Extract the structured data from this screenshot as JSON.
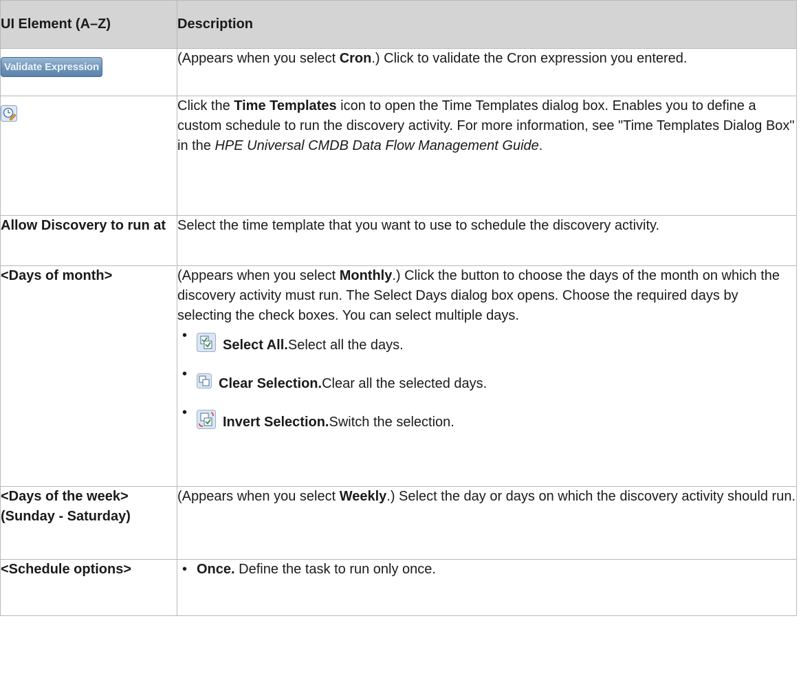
{
  "table": {
    "headers": {
      "element": "UI Element (A–Z)",
      "description": "Description"
    },
    "validate": {
      "button_label": "Validate Expression",
      "pre": "(Appears when you select ",
      "bold": "Cron",
      "post": ".) Click to validate the Cron expression you entered."
    },
    "time_templates": {
      "pre": "Click the ",
      "bold": "Time Templates",
      "mid": " icon to open the Time Templates dialog box. Enables you to define a custom schedule to run the discovery activity. For more information, see \"Time Templates Dialog Box\" in the ",
      "italic": "HPE Universal CMDB Data Flow Management Guide",
      "post": "."
    },
    "allow": {
      "element": "Allow Discovery to run at",
      "description": "Select the time template that you want to use to schedule the discovery activity."
    },
    "days_of_month": {
      "element": "<Days of month>",
      "pre": "(Appears when you select ",
      "bold": "Monthly",
      "post": ".) Click the button to choose the days of the month on which the discovery activity must run. The Select Days dialog box opens. Choose the required days by selecting the check boxes. You can select multiple days.",
      "options": [
        {
          "icon": "select-all-icon",
          "bold": "Select All.",
          "text": " Select all the days."
        },
        {
          "icon": "clear-selection-icon",
          "bold": "Clear Selection.",
          "text": " Clear all the selected days."
        },
        {
          "icon": "invert-selection-icon",
          "bold": "Invert Selection.",
          "text": " Switch the selection."
        }
      ]
    },
    "days_of_week": {
      "element": "<Days of the week> (Sunday - Saturday)",
      "pre": "(Appears when you select ",
      "bold": "Weekly",
      "post": ".) Select the day or days on which the discovery activity should run."
    },
    "schedule": {
      "element": "<Schedule options>",
      "items": [
        {
          "bold": "Once.",
          "text": " Define the task to run only once."
        }
      ]
    }
  }
}
